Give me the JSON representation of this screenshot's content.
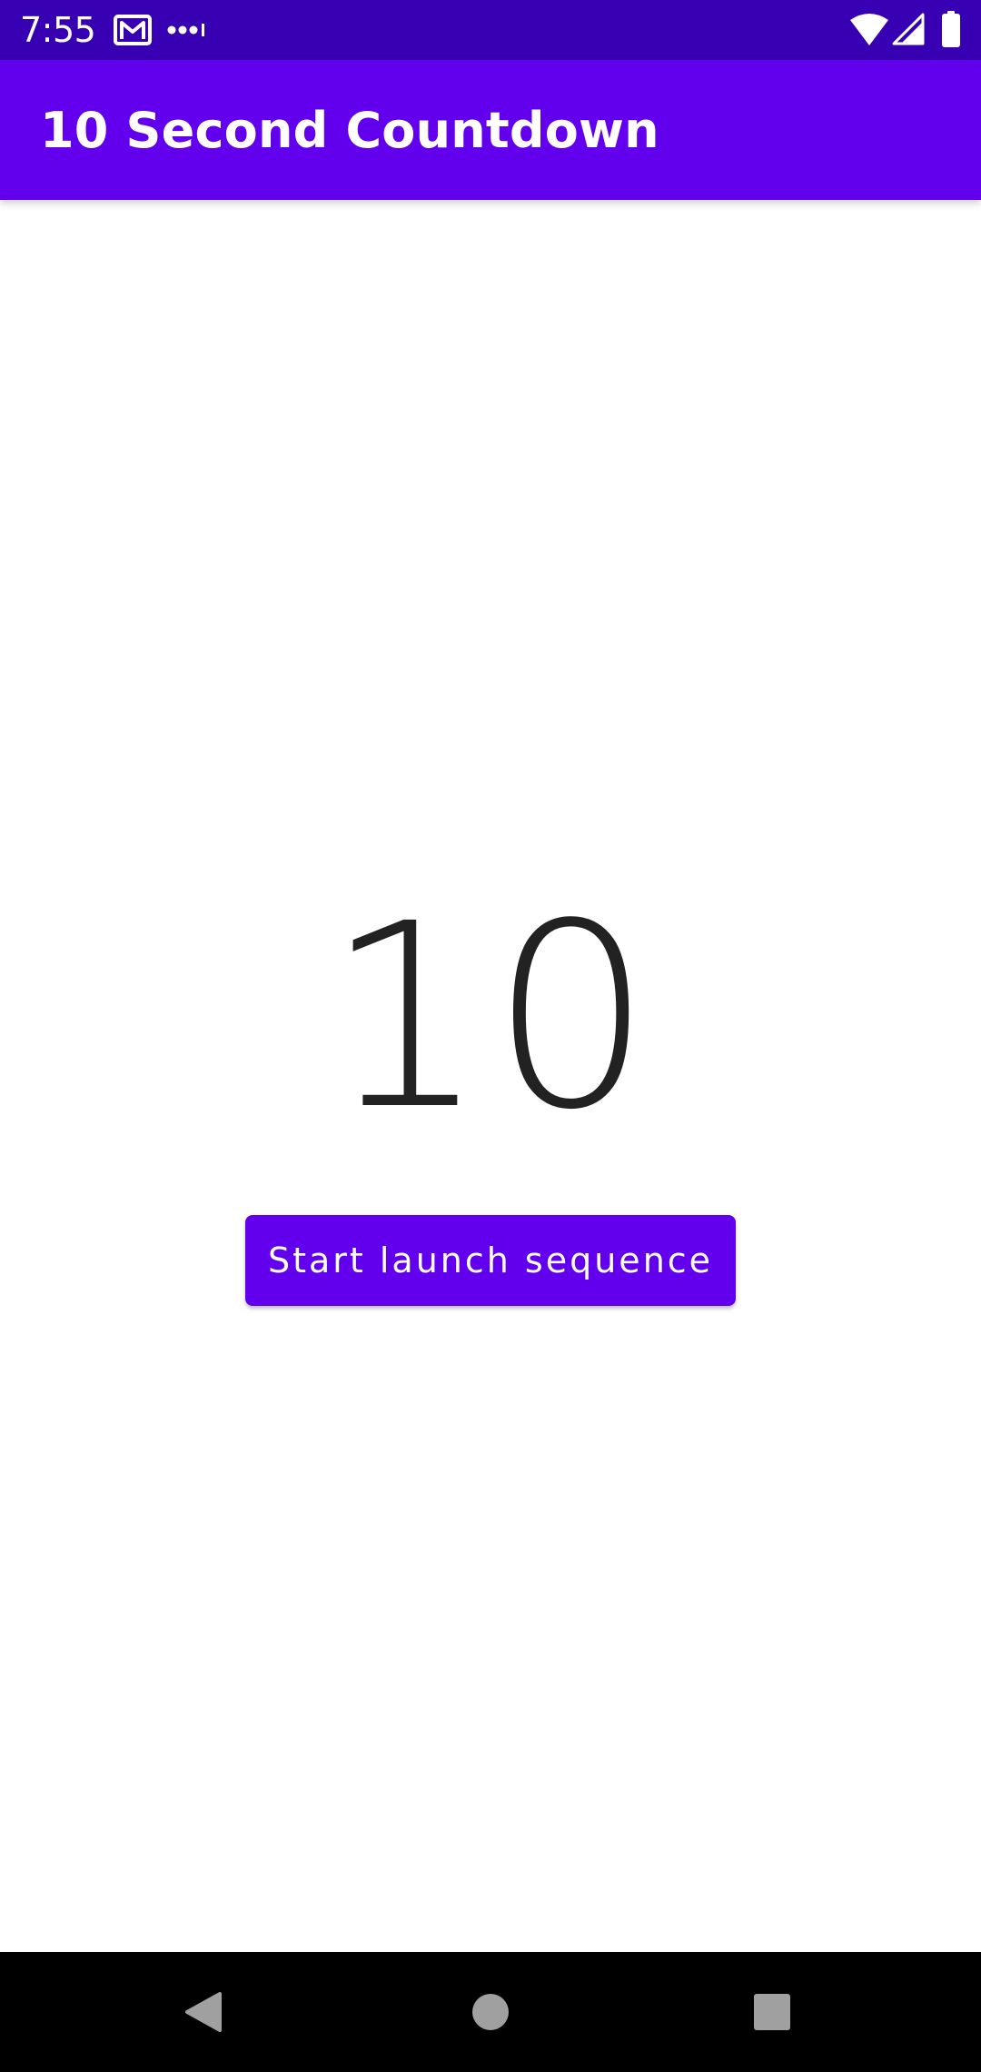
{
  "status_bar": {
    "time": "7:55",
    "icons": [
      "gmail-icon",
      "more-notifications-icon",
      "wifi-icon",
      "signal-icon",
      "battery-icon"
    ],
    "background": "#3700B3"
  },
  "app_bar": {
    "title": "10 Second Countdown",
    "background": "#6200EE"
  },
  "main": {
    "countdown_value": "10",
    "start_button_label": "Start launch sequence",
    "accent": "#6200EE"
  },
  "nav_bar": {
    "icons": [
      "back-icon",
      "home-icon",
      "recents-icon"
    ]
  }
}
